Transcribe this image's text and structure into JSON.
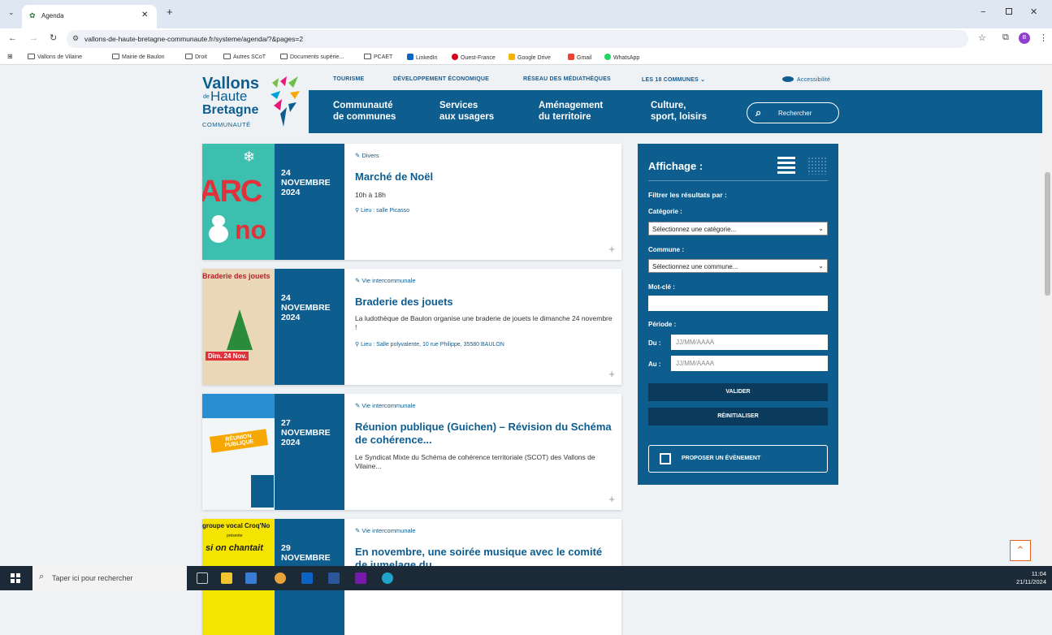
{
  "browser": {
    "tab_title": "Agenda",
    "url": "vallons-de-haute-bretagne-communaute.fr/systeme/agenda/?&pages=2",
    "profile_initial": "B",
    "bookmarks": [
      "Vallons de Vilaine",
      "Mairie de Baulon",
      "Droit",
      "Autres SCoT",
      "Documents supérie...",
      "PCAET",
      "LinkedIn",
      "Ouest-France",
      "Google Drive",
      "Gmail",
      "WhatsApp"
    ]
  },
  "site": {
    "logo": {
      "line1": "Vallons",
      "line2": "de",
      "line3": "Haute",
      "line4": "Bretagne",
      "line5": "COMMUNAUTÉ"
    },
    "topnav": [
      "TOURISME",
      "DÉVELOPPEMENT ÉCONOMIQUE",
      "RÉSEAU DES MÉDIATHÈQUES",
      "LES 18 COMMUNES",
      "Accessibilité"
    ],
    "mainnav": [
      {
        "l1": "Communauté",
        "l2": "de communes"
      },
      {
        "l1": "Services",
        "l2": "aux usagers"
      },
      {
        "l1": "Aménagement",
        "l2": "du territoire"
      },
      {
        "l1": "Culture,",
        "l2": "sport, loisirs"
      }
    ],
    "search_label": "Rechercher"
  },
  "events": [
    {
      "day": "24",
      "month": "NOVEMBRE",
      "year": "2024",
      "category": "Divers",
      "title": "Marché de Noël",
      "desc": "10h à 18h",
      "location": "Lieu : salle Picasso"
    },
    {
      "day": "24",
      "month": "NOVEMBRE",
      "year": "2024",
      "category": "Vie intercommunale",
      "title": "Braderie des jouets",
      "desc": "La ludothèque de Baulon organise une braderie de jouets le dimanche 24 novembre !",
      "location": "Lieu : Salle polyvalente, 10 rue Philippe, 35580 BAULON"
    },
    {
      "day": "27",
      "month": "NOVEMBRE",
      "year": "2024",
      "category": "Vie intercommunale",
      "title": "Réunion publique (Guichen) – Révision du Schéma de cohérence...",
      "desc": "Le Syndicat Mixte du Schéma de cohérence territoriale (SCOT) des Vallons de Vilaine...",
      "location": ""
    },
    {
      "day": "29",
      "month": "NOVEMBRE",
      "year": "",
      "category": "Vie intercommunale",
      "title": "En novembre, une soirée musique avec le comité de jumelage du...",
      "desc": "",
      "location": ""
    }
  ],
  "thumbs": {
    "t1": "ARC",
    "t1b": "no",
    "t2": "Braderie des jouets",
    "t2b": "Dim. 24 Nov.",
    "t3": "RÉUNION PUBLIQUE",
    "t4": "groupe vocal Croq'No",
    "t4b": "présente",
    "t4c": "si on chantait"
  },
  "sidebar": {
    "title": "Affichage :",
    "filter_title": "Filtrer les résultats par :",
    "category_label": "Catégorie :",
    "category_value": "Sélectionnez une catégorie...",
    "commune_label": "Commune :",
    "commune_value": "Sélectionnez une commune...",
    "keyword_label": "Mot-clé :",
    "period_label": "Période :",
    "from_label": "Du :",
    "from_placeholder": "JJ/MM/AAAA",
    "to_label": "Au :",
    "to_placeholder": "JJ/MM/AAAA",
    "validate": "VALIDER",
    "reset": "RÉINITIALISER",
    "propose": "PROPOSER UN ÉVÈNEMENT"
  },
  "taskbar": {
    "search_placeholder": "Taper ici pour rechercher",
    "time": "11:04",
    "date": "21/11/2024"
  },
  "colors": {
    "brand_blue": "#0d5d8f",
    "dark_button": "#0a3b5c"
  }
}
